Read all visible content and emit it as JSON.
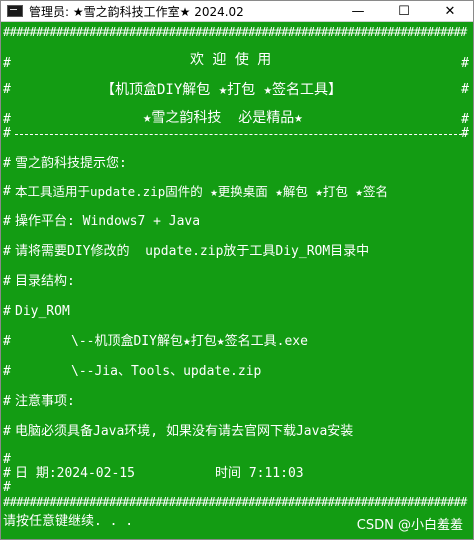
{
  "window": {
    "title": "管理员: ★雪之韵科技工作室★ 2024.02",
    "minimize_glyph": "—",
    "maximize_glyph": "☐",
    "close_glyph": "✕",
    "icon": "console-icon"
  },
  "console": {
    "border_top": "######################################################################",
    "border_bottom": "######################################################################",
    "welcome": "欢 迎 使 用",
    "product": "【机顶盒DIY解包 ★打包 ★签名工具】",
    "brand": "★雪之韵科技  必是精品★",
    "tip_header": "雪之韵科技提示您:",
    "tip_line1": "本工具适用于update.zip固件的 ★更换桌面 ★解包 ★打包 ★签名",
    "platform": "操作平台: Windows7 + Java",
    "instruction": "请将需要DIY修改的  update.zip放于工具Diy_ROM目录中",
    "dir_header": "目录结构:",
    "dir_root": "Diy_ROM",
    "dir_item1": "\\--机顶盒DIY解包★打包★签名工具.exe",
    "dir_item2": "\\--Jia、Tools、update.zip",
    "note_header": "注意事项:",
    "note_line1": "电脑必须具备Java环境, 如果没有请去官网下载Java安装",
    "date_label": "日 期:2024-02-15",
    "time_label": "时间 7:11:03",
    "prompt": "请按任意键继续. . ."
  },
  "watermark": "CSDN @小白羞羞",
  "colors": {
    "console_bg": "#139c13",
    "text": "#ffffff"
  }
}
